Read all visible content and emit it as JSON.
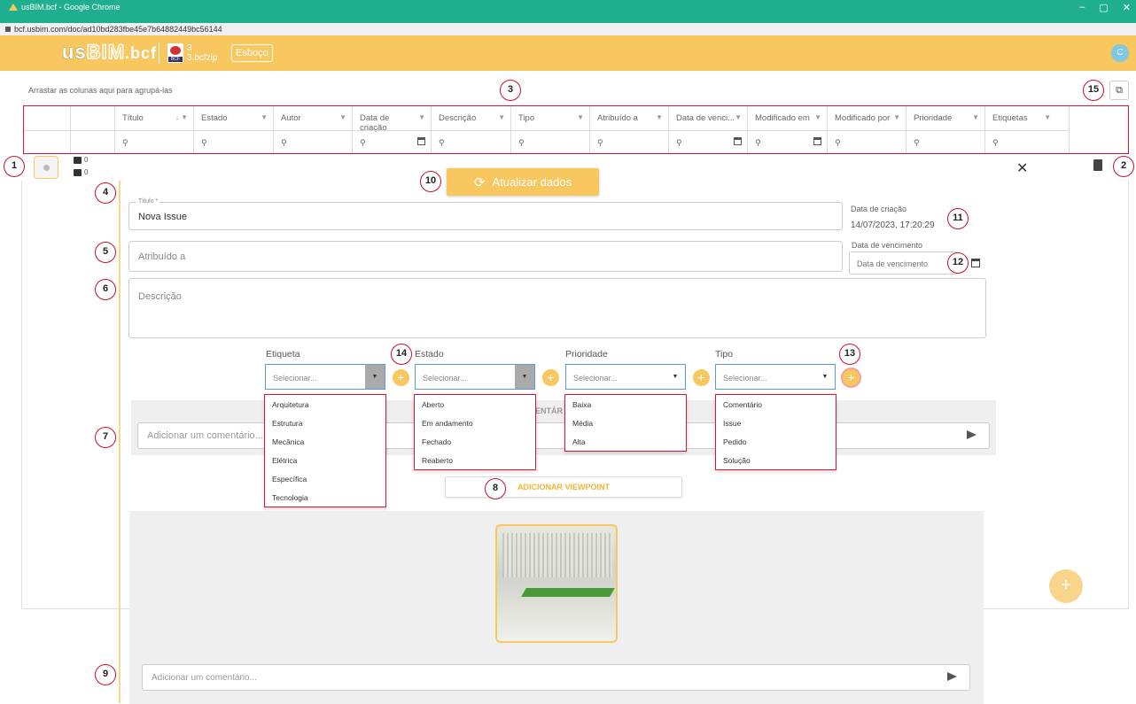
{
  "window": {
    "title": "usBIM.bcf - Google Chrome",
    "controls": [
      "–",
      "▢",
      "✕"
    ]
  },
  "address_bar": {
    "url": "bcf.usbim.com/doc/ad10bd283fbe45e7b64882449bc56144"
  },
  "header": {
    "logo_us": "us",
    "logo_bim": "BIM",
    "logo_bcf": ".bcf",
    "file_badge": "BCF",
    "file_line1": "3",
    "file_line2": "3.bcfzip",
    "draft_label": "Esboço",
    "avatar": "C"
  },
  "grid": {
    "group_hint": "Arrastar as colunas aqui para agrupá-las",
    "columns": [
      "Título",
      "Estado",
      "Autor",
      "Data de criação",
      "Descrição",
      "Tipo",
      "Atribuído a",
      "Data de venci...",
      "Modificado em",
      "Modificado por",
      "Prioridade",
      "Etiquetas"
    ],
    "sort_indicator": "↓"
  },
  "row": {
    "comments_count": "0",
    "images_count": "0"
  },
  "actions": {
    "refresh_label": "Atualizar dados",
    "close": "✕"
  },
  "form": {
    "title_label": "Título *",
    "title_value": "Nova Issue",
    "assigned_placeholder": "Atribuído a",
    "description_placeholder": "Descrição",
    "created_label": "Data de criação",
    "created_value": "14/07/2023, 17:20:29",
    "due_label": "Data de vencimento",
    "due_placeholder": "Data de vencimento"
  },
  "selects": {
    "etiqueta": {
      "label": "Etiqueta",
      "placeholder": "Selecionar...",
      "options": [
        "Arquitetura",
        "Estrutura",
        "Mecânica",
        "Elétrica",
        "Específica",
        "Tecnologia"
      ]
    },
    "estado": {
      "label": "Estado",
      "placeholder": "Selecionar...",
      "options": [
        "Aberto",
        "Em andamento",
        "Fechado",
        "Reaberto"
      ]
    },
    "prioridade": {
      "label": "Prioridade",
      "placeholder": "Selecionar...",
      "options": [
        "Baixa",
        "Média",
        "Alta"
      ]
    },
    "tipo": {
      "label": "Tipo",
      "placeholder": "Selecionar...",
      "options": [
        "Comentário",
        "Issue",
        "Pedido",
        "Solução"
      ]
    }
  },
  "comments": {
    "title_partial": "ENTÁR",
    "placeholder": "Adicionar um comentário...",
    "placeholder_short": "Adicionar um comentário..."
  },
  "viewpoint": {
    "add_label": "ADICIONAR VIEWPOINT"
  },
  "annotations": [
    "1",
    "2",
    "3",
    "4",
    "5",
    "6",
    "7",
    "8",
    "9",
    "10",
    "11",
    "12",
    "13",
    "14",
    "15"
  ],
  "colors": {
    "accent": "#f8c760",
    "chrome": "#1faf8f",
    "highlight": "#e0142b"
  }
}
